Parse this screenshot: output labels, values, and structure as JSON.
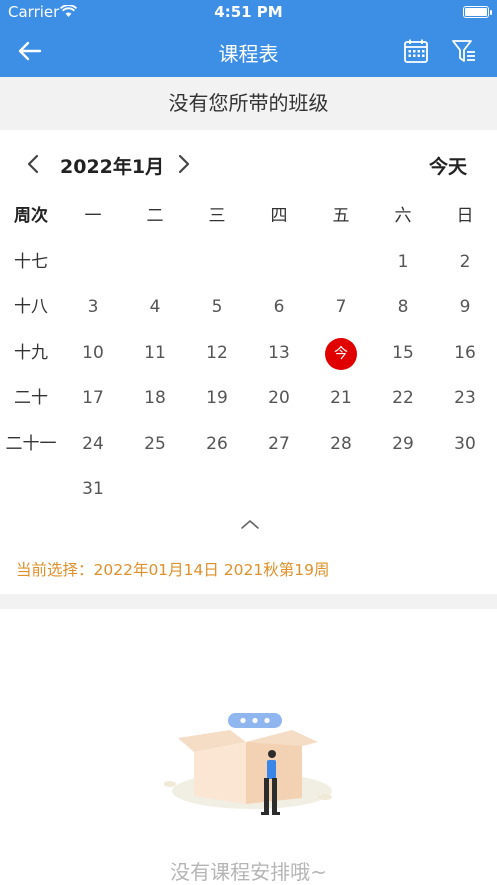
{
  "status_bar": {
    "carrier": "Carrier",
    "time": "4:51 PM"
  },
  "nav": {
    "title": "课程表",
    "back_icon": "arrow-left-icon",
    "calendar_icon": "calendar-icon",
    "filter_icon": "filter-icon"
  },
  "banner": {
    "text": "没有您所带的班级"
  },
  "calendar": {
    "month_label": "2022年1月",
    "today_label": "今天",
    "week_header": "周次",
    "weekdays": [
      "一",
      "二",
      "三",
      "四",
      "五",
      "六",
      "日"
    ],
    "weeks": [
      {
        "label": "十七",
        "days": [
          "",
          "",
          "",
          "",
          "",
          "1",
          "2"
        ]
      },
      {
        "label": "十八",
        "days": [
          "3",
          "4",
          "5",
          "6",
          "7",
          "8",
          "9"
        ]
      },
      {
        "label": "十九",
        "days": [
          "10",
          "11",
          "12",
          "13",
          "今",
          "15",
          "16"
        ]
      },
      {
        "label": "二十",
        "days": [
          "17",
          "18",
          "19",
          "20",
          "21",
          "22",
          "23"
        ]
      },
      {
        "label": "二十一",
        "days": [
          "24",
          "25",
          "26",
          "27",
          "28",
          "29",
          "30"
        ]
      },
      {
        "label": "",
        "days": [
          "31",
          "",
          "",
          "",
          "",
          "",
          ""
        ]
      }
    ],
    "today_marker": "今",
    "today_color": "#e10000"
  },
  "selection": {
    "text": "当前选择：2022年01月14日 2021秋第19周"
  },
  "empty_state": {
    "text": "没有课程安排哦~",
    "illustration": "empty-box-illustration"
  },
  "colors": {
    "primary": "#3d8fe6",
    "accent": "#e0902a",
    "muted": "#b5b5b5"
  }
}
